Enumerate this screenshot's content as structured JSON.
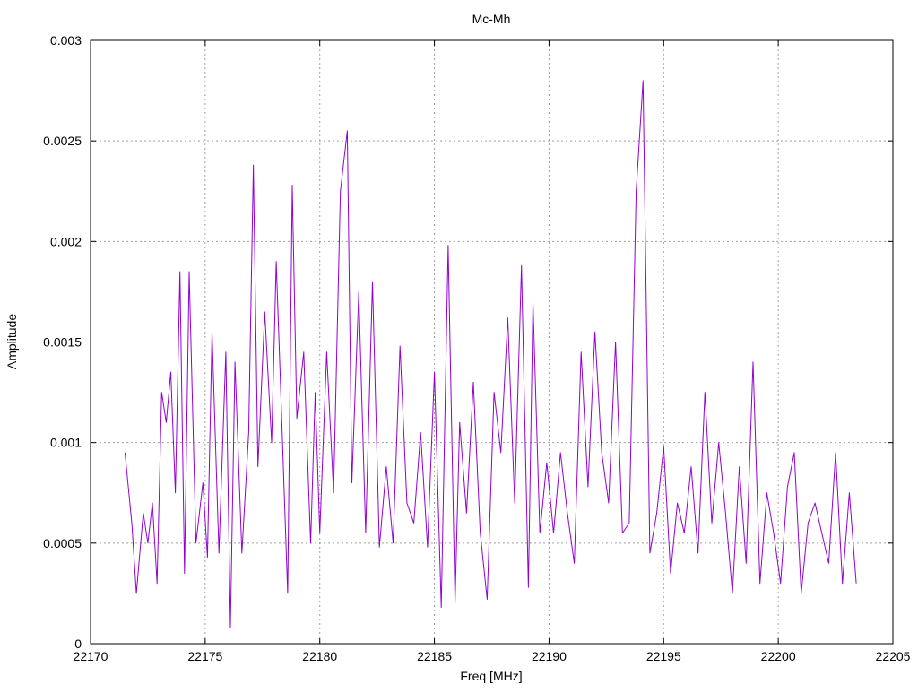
{
  "chart_data": {
    "type": "line",
    "title": "Mc-Mh",
    "xlabel": "Freq [MHz]",
    "ylabel": "Amplitude",
    "xlim": [
      22170,
      22205
    ],
    "ylim": [
      0,
      0.003
    ],
    "xticks": [
      22170,
      22175,
      22180,
      22185,
      22190,
      22195,
      22200,
      22205
    ],
    "yticks": [
      0,
      0.0005,
      0.001,
      0.0015,
      0.002,
      0.0025,
      0.003
    ],
    "xtick_labels": [
      "22170",
      "22175",
      "22180",
      "22185",
      "22190",
      "22195",
      "22200",
      "22205"
    ],
    "ytick_labels": [
      "0",
      "0.0005",
      "0.001",
      "0.0015",
      "0.002",
      "0.0025",
      "0.003"
    ],
    "grid": true,
    "legend": "none",
    "series": [
      {
        "color": "#9400d3",
        "x": [
          22171.5,
          22171.8,
          22172.0,
          22172.3,
          22172.5,
          22172.7,
          22172.9,
          22173.1,
          22173.3,
          22173.5,
          22173.7,
          22173.9,
          22174.1,
          22174.3,
          22174.6,
          22174.9,
          22175.1,
          22175.3,
          22175.6,
          22175.9,
          22176.1,
          22176.3,
          22176.6,
          22176.9,
          22177.1,
          22177.3,
          22177.6,
          22177.9,
          22178.1,
          22178.3,
          22178.6,
          22178.8,
          22179.0,
          22179.3,
          22179.6,
          22179.8,
          22180.0,
          22180.3,
          22180.6,
          22180.9,
          22181.2,
          22181.4,
          22181.7,
          22182.0,
          22182.3,
          22182.6,
          22182.9,
          22183.2,
          22183.5,
          22183.8,
          22184.1,
          22184.4,
          22184.7,
          22185.0,
          22185.3,
          22185.6,
          22185.9,
          22186.1,
          22186.4,
          22186.7,
          22187.0,
          22187.3,
          22187.6,
          22187.9,
          22188.2,
          22188.5,
          22188.8,
          22189.1,
          22189.3,
          22189.6,
          22189.9,
          22190.2,
          22190.5,
          22190.8,
          22191.1,
          22191.4,
          22191.7,
          22192.0,
          22192.3,
          22192.6,
          22192.9,
          22193.2,
          22193.5,
          22193.8,
          22194.1,
          22194.4,
          22194.7,
          22195.0,
          22195.3,
          22195.6,
          22195.9,
          22196.2,
          22196.5,
          22196.8,
          22197.1,
          22197.4,
          22197.7,
          22198.0,
          22198.3,
          22198.6,
          22198.9,
          22199.2,
          22199.5,
          22199.8,
          22200.1,
          22200.4,
          22200.7,
          22201.0,
          22201.3,
          22201.6,
          22201.9,
          22202.2,
          22202.5,
          22202.8,
          22203.1,
          22203.4
        ],
        "y": [
          0.00095,
          0.0006,
          0.00025,
          0.00065,
          0.0005,
          0.0007,
          0.0003,
          0.00125,
          0.0011,
          0.00135,
          0.00075,
          0.00185,
          0.00035,
          0.00185,
          0.0005,
          0.0008,
          0.00043,
          0.00155,
          0.00045,
          0.00145,
          8e-05,
          0.0014,
          0.00045,
          0.00105,
          0.00238,
          0.00088,
          0.00165,
          0.001,
          0.0019,
          0.00125,
          0.00025,
          0.00228,
          0.00112,
          0.00145,
          0.0005,
          0.00125,
          0.00055,
          0.00145,
          0.00075,
          0.00225,
          0.00255,
          0.0008,
          0.00175,
          0.00055,
          0.0018,
          0.00048,
          0.00088,
          0.0005,
          0.00148,
          0.0007,
          0.0006,
          0.00105,
          0.00048,
          0.00135,
          0.00018,
          0.00198,
          0.0002,
          0.0011,
          0.00065,
          0.0013,
          0.00055,
          0.00022,
          0.00125,
          0.00095,
          0.00162,
          0.0007,
          0.00188,
          0.00028,
          0.0017,
          0.00055,
          0.0009,
          0.00055,
          0.00095,
          0.00065,
          0.0004,
          0.00145,
          0.00078,
          0.00155,
          0.00095,
          0.0007,
          0.0015,
          0.00055,
          0.0006,
          0.00225,
          0.0028,
          0.00045,
          0.00065,
          0.00098,
          0.00035,
          0.0007,
          0.00055,
          0.00088,
          0.00045,
          0.00125,
          0.0006,
          0.001,
          0.00065,
          0.00025,
          0.00088,
          0.0004,
          0.0014,
          0.0003,
          0.00075,
          0.00055,
          0.0003,
          0.00078,
          0.00095,
          0.00025,
          0.0006,
          0.0007,
          0.00055,
          0.0004,
          0.00095,
          0.0003,
          0.00075,
          0.0003
        ]
      }
    ]
  }
}
